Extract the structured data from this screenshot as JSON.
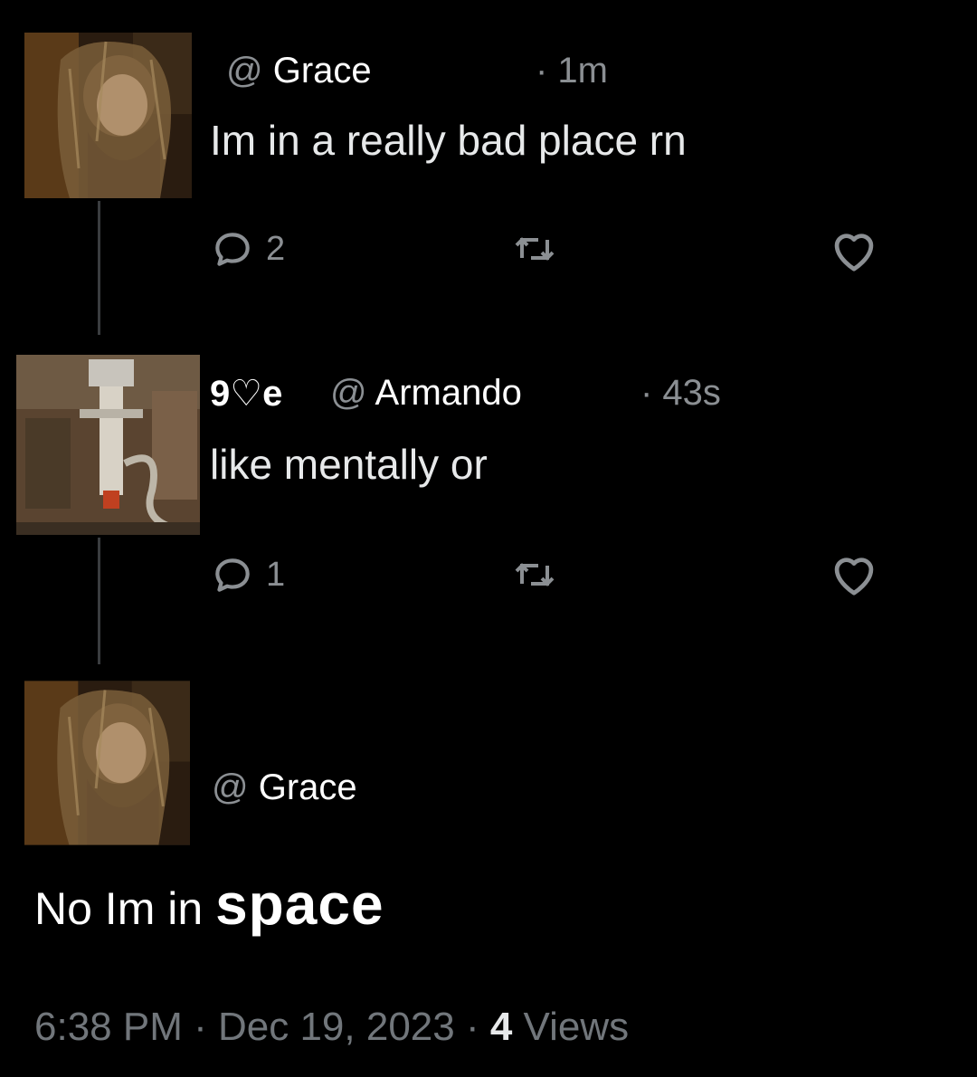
{
  "tweets": [
    {
      "at": "@",
      "handle": "Grace",
      "time": "· 1m",
      "text": "Im in a really bad place rn",
      "replies": "2",
      "avatar_icon": "bearded-man-avatar"
    },
    {
      "display_name": "9♡e",
      "at": "@",
      "handle": "Armando",
      "time": "· 43s",
      "text": "like mentally or",
      "replies": "1",
      "avatar_icon": "robot-avatar"
    }
  ],
  "final": {
    "at": "@",
    "handle": "Grace",
    "text_prefix": "No Im in ",
    "text_emphasis": "space",
    "time": "6:38 PM",
    "sep1": " · ",
    "date": "Dec 19, 2023",
    "sep2": " · ",
    "views_count": "4",
    "views_label": " Views",
    "avatar_icon": "bearded-man-avatar"
  },
  "colors": {
    "background": "#000000",
    "text": "#e7e9ea",
    "muted": "#8b8f93"
  }
}
